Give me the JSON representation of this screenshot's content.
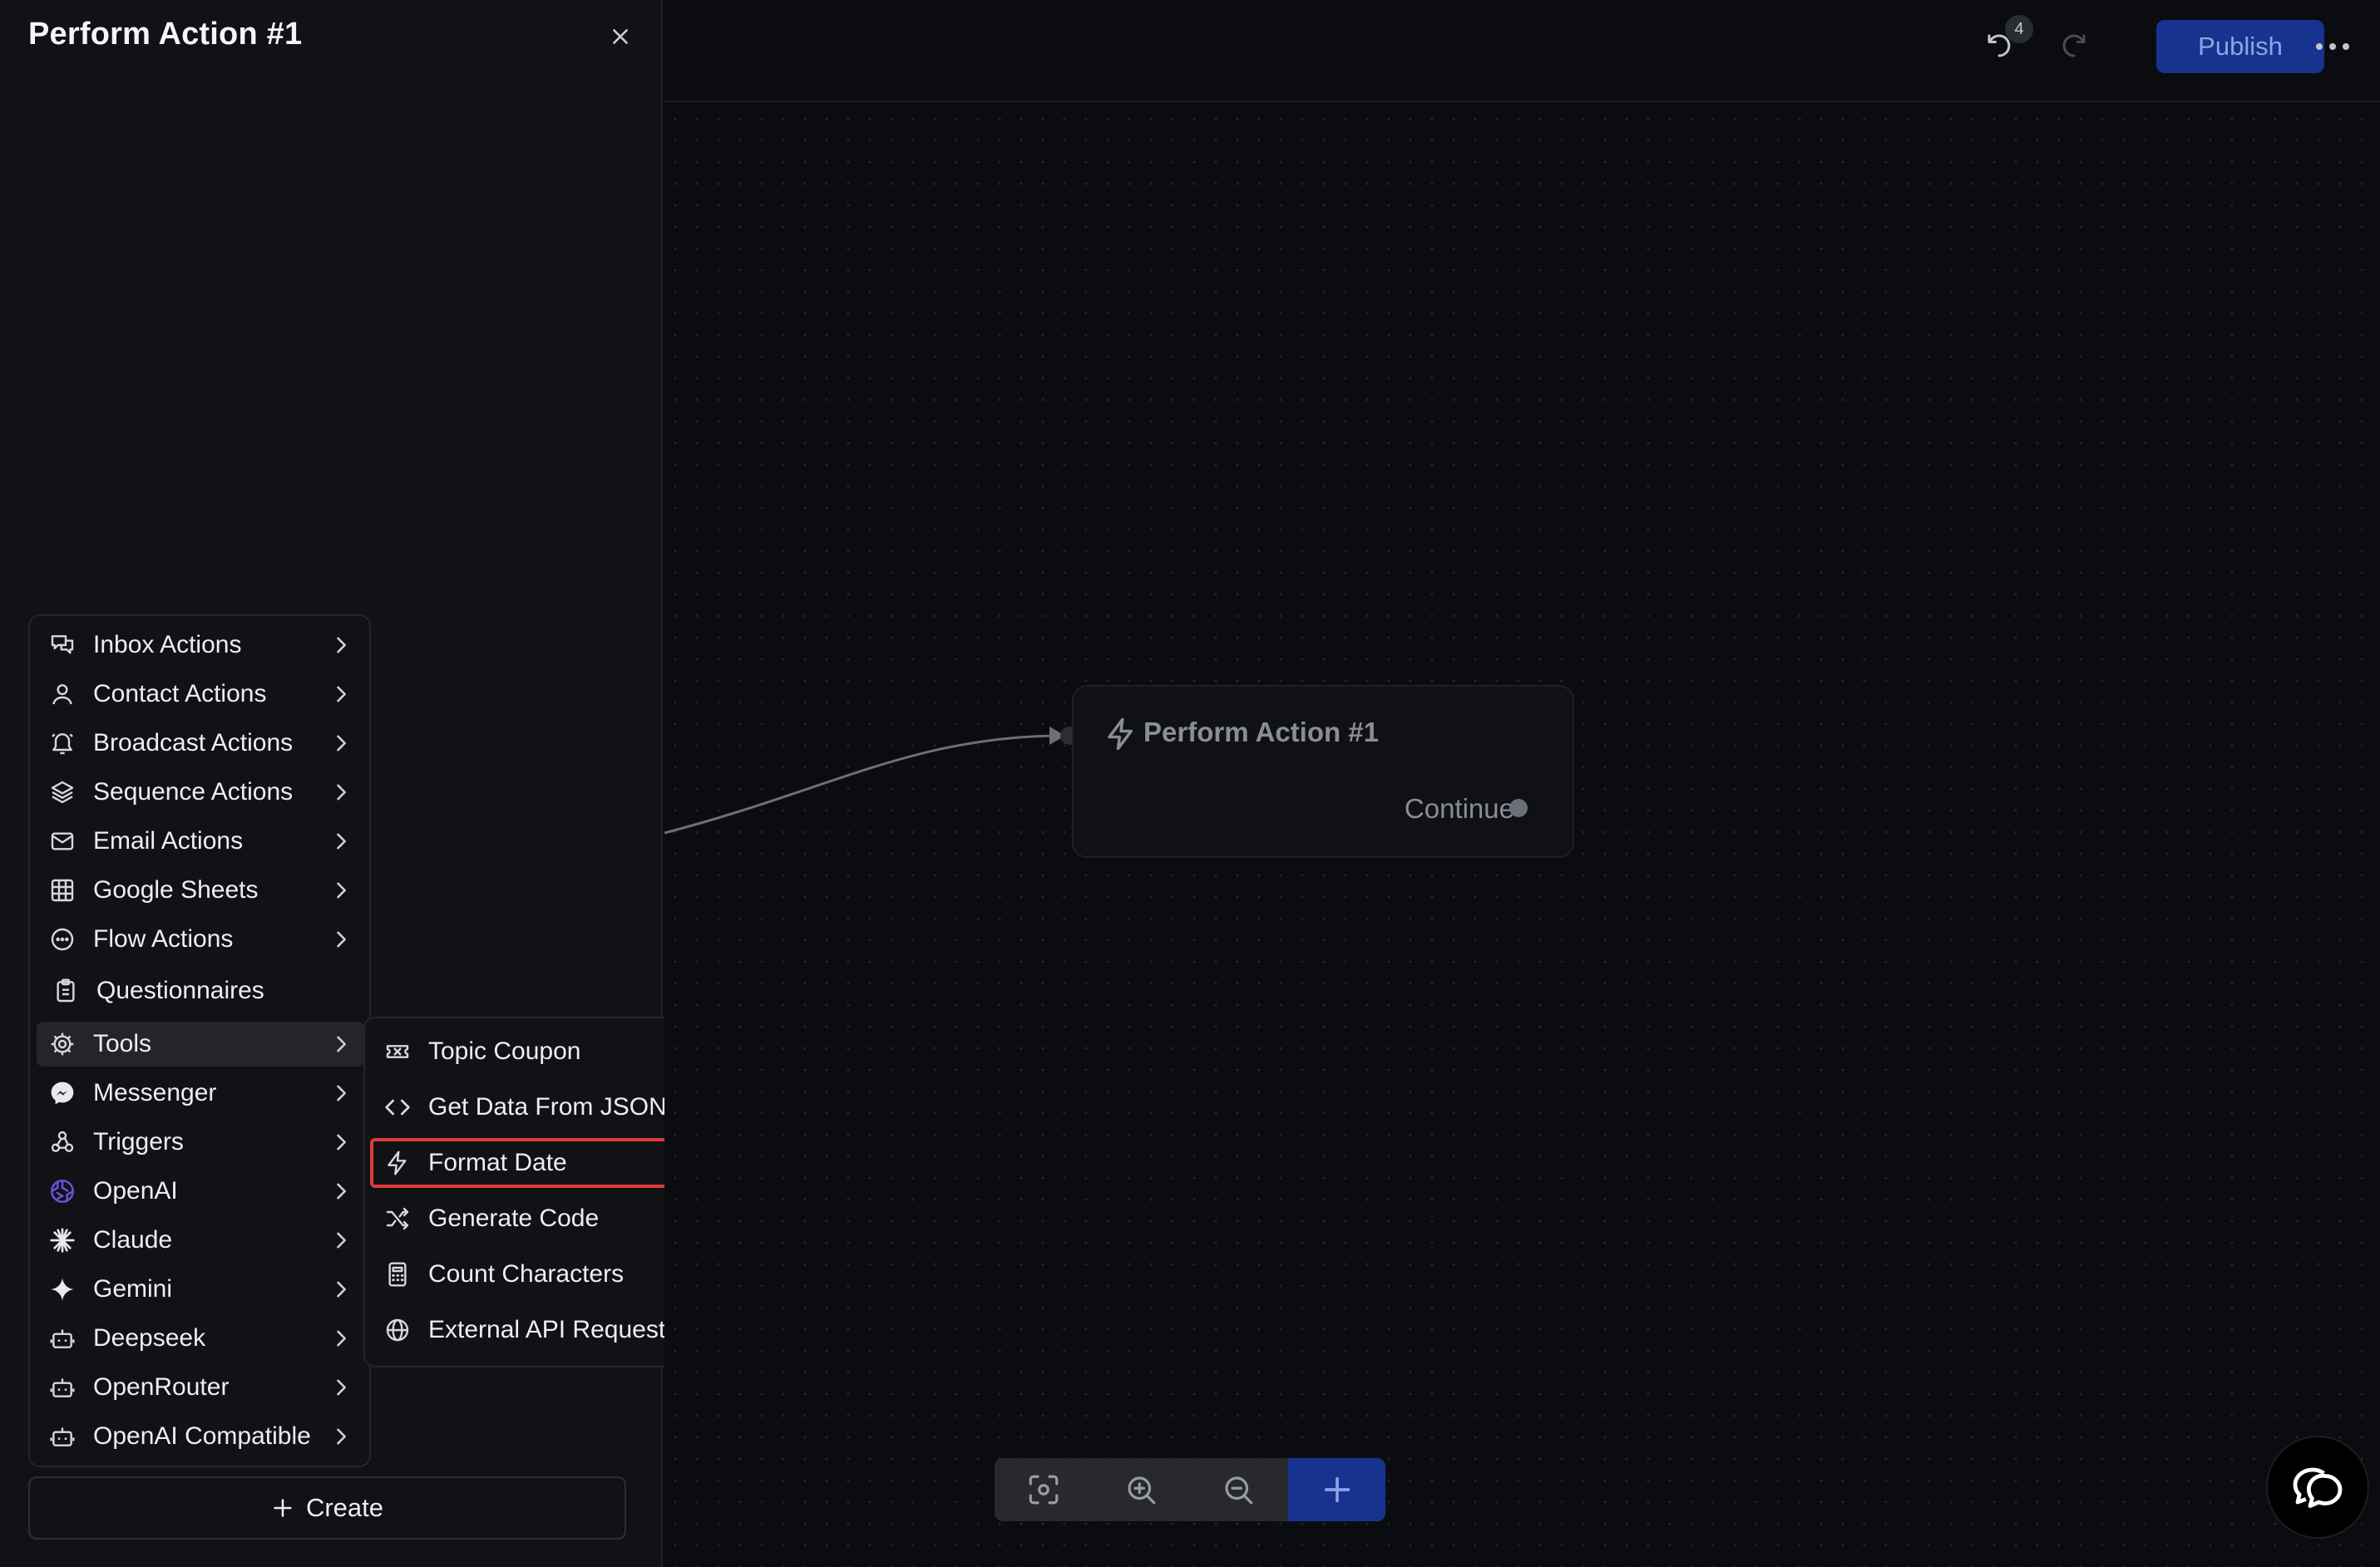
{
  "panel": {
    "title": "Perform Action #1"
  },
  "menu": {
    "items": [
      {
        "label": "Inbox Actions",
        "icon": "chat-bubbles-icon",
        "has_submenu": true
      },
      {
        "label": "Contact Actions",
        "icon": "user-icon",
        "has_submenu": true
      },
      {
        "label": "Broadcast Actions",
        "icon": "bell-icon",
        "has_submenu": true
      },
      {
        "label": "Sequence Actions",
        "icon": "layers-icon",
        "has_submenu": true
      },
      {
        "label": "Email Actions",
        "icon": "mail-icon",
        "has_submenu": true
      },
      {
        "label": "Google Sheets",
        "icon": "table-icon",
        "has_submenu": true
      },
      {
        "label": "Flow Actions",
        "icon": "dots-circle-icon",
        "has_submenu": true
      },
      {
        "label": "Questionnaires",
        "icon": "clipboard-icon",
        "has_submenu": false
      },
      {
        "label": "Tools",
        "icon": "gear-icon",
        "has_submenu": true,
        "active": true
      },
      {
        "label": "Messenger",
        "icon": "messenger-icon",
        "has_submenu": true
      },
      {
        "label": "Triggers",
        "icon": "webhook-icon",
        "has_submenu": true
      },
      {
        "label": "OpenAI",
        "icon": "openai-icon",
        "has_submenu": true
      },
      {
        "label": "Claude",
        "icon": "claude-icon",
        "has_submenu": true
      },
      {
        "label": "Gemini",
        "icon": "gemini-icon",
        "has_submenu": true
      },
      {
        "label": "Deepseek",
        "icon": "bot-icon",
        "has_submenu": true
      },
      {
        "label": "OpenRouter",
        "icon": "bot-icon",
        "has_submenu": true
      },
      {
        "label": "OpenAI Compatible",
        "icon": "bot-icon",
        "has_submenu": true
      }
    ]
  },
  "submenu": {
    "items": [
      {
        "label": "Topic Coupon",
        "icon": "ticket-icon"
      },
      {
        "label": "Get Data From JSON",
        "icon": "code-icon"
      },
      {
        "label": "Format Date",
        "icon": "lightning-icon",
        "highlighted": true
      },
      {
        "label": "Generate Code",
        "icon": "shuffle-icon"
      },
      {
        "label": "Count Characters",
        "icon": "calculator-icon"
      },
      {
        "label": "External API Request",
        "icon": "globe-icon"
      }
    ]
  },
  "create_button": {
    "label": "Create"
  },
  "topbar": {
    "undo_count": "4",
    "publish_label": "Publish"
  },
  "node": {
    "title": "Perform Action #1",
    "output_label": "Continue"
  },
  "colors": {
    "accent": "#17338f",
    "highlight_border": "#e03a3a",
    "panel_bg": "#111216",
    "canvas_bg": "#0b0c0f"
  }
}
